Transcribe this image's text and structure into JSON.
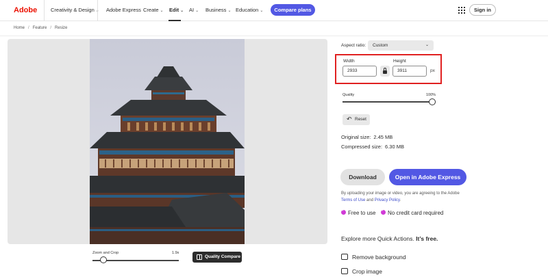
{
  "nav": {
    "logo": "Adobe",
    "items": [
      {
        "label": "Creativity & Design",
        "chevron": true
      },
      {
        "label": "Adobe Express",
        "chevron": false
      },
      {
        "label": "Create",
        "chevron": true
      },
      {
        "label": "Edit",
        "chevron": true
      },
      {
        "label": "AI",
        "chevron": true
      },
      {
        "label": "Business",
        "chevron": true
      },
      {
        "label": "Education",
        "chevron": true
      }
    ],
    "cta": "Compare plans",
    "apps_icon": "grid-icon",
    "signin": "Sign in"
  },
  "breadcrumb": [
    "Home",
    "Feature",
    "Resize"
  ],
  "editor": {
    "zoom_label": "Zoom and Crop",
    "zoom_value": "1.9x",
    "quality_compare": "Quality Compare"
  },
  "settings": {
    "aspect_label": "Aspect ratio:",
    "aspect_value": "Custom",
    "width_label": "Width",
    "width_value": "2933",
    "height_label": "Height",
    "height_value": "3911",
    "unit": "px",
    "quality_label": "Quality",
    "quality_value": "100%",
    "reset": "Reset",
    "original_label": "Original size:",
    "original_value": "2.45 MB",
    "compressed_label": "Compressed size:",
    "compressed_value": "6.30 MB"
  },
  "actions": {
    "download": "Download",
    "open": "Open in Adobe Express"
  },
  "terms": {
    "prefix": "By uploading your image or video, you are agreeing to the Adobe",
    "terms_link": "Terms of Use",
    "and": "and",
    "privacy_link": "Privacy Policy",
    "suffix": "."
  },
  "badges": [
    "Free to use",
    "No credit card required"
  ],
  "quick_actions": {
    "heading_prefix": "Explore more Quick Actions.",
    "heading_suffix": "It’s free.",
    "items": [
      "Remove background",
      "Crop image"
    ]
  },
  "colors": {
    "brand_red": "#eb1000",
    "accent_blue": "#5258e4",
    "highlight_red": "#e02020",
    "badge_pink": "#d03ad6"
  }
}
